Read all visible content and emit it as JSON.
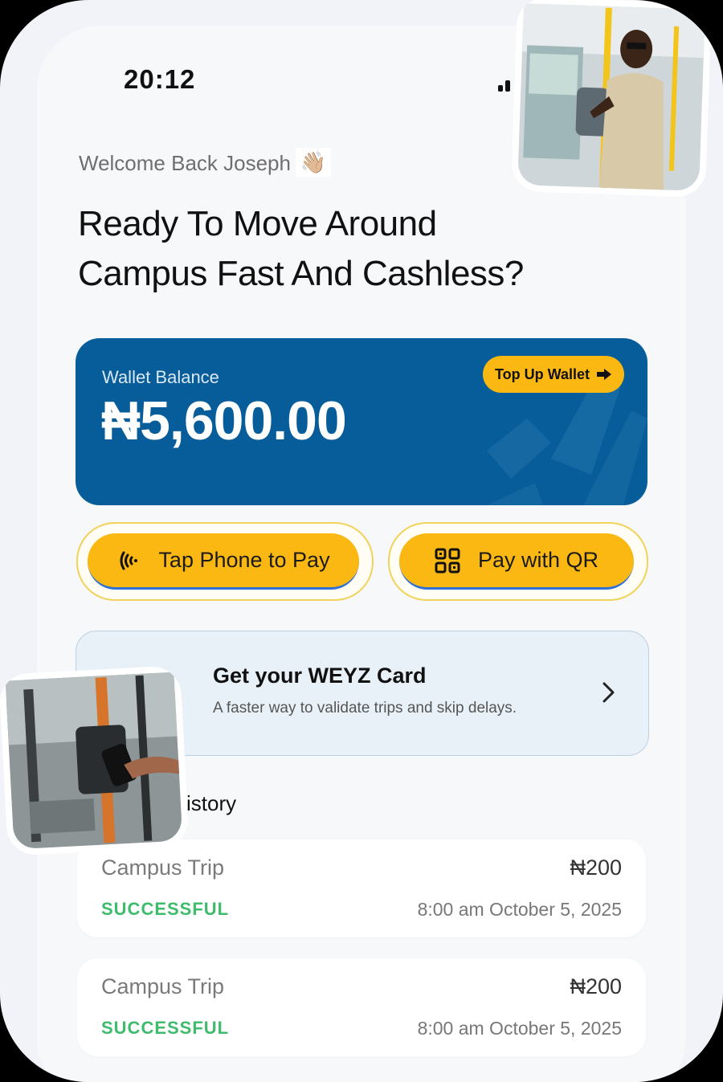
{
  "status_bar": {
    "time": "20:12"
  },
  "greeting": {
    "welcome": "Welcome Back Joseph",
    "wave_emoji": "👋🏼"
  },
  "headline": {
    "line1": "Ready To Move Around",
    "line2": "Campus Fast And Cashless?"
  },
  "wallet": {
    "label": "Wallet Balance",
    "balance": "₦5,600.00",
    "top_up_label": "Top Up Wallet",
    "card_color": "#075d99"
  },
  "actions": {
    "tap_to_pay_label": "Tap Phone to Pay",
    "pay_qr_label": "Pay with QR",
    "accent_color": "#fbb812"
  },
  "promo": {
    "title": "Get your WEYZ Card",
    "subtitle": "A faster way to validate trips and skip delays."
  },
  "history": {
    "heading": "istory",
    "items": [
      {
        "name": "Campus Trip",
        "status": "SUCCESSFUL",
        "amount": "₦200",
        "time": "8:00 am October 5, 2025"
      },
      {
        "name": "Campus Trip",
        "status": "SUCCESSFUL",
        "amount": "₦200",
        "time": "8:00 am October 5, 2025"
      }
    ]
  }
}
